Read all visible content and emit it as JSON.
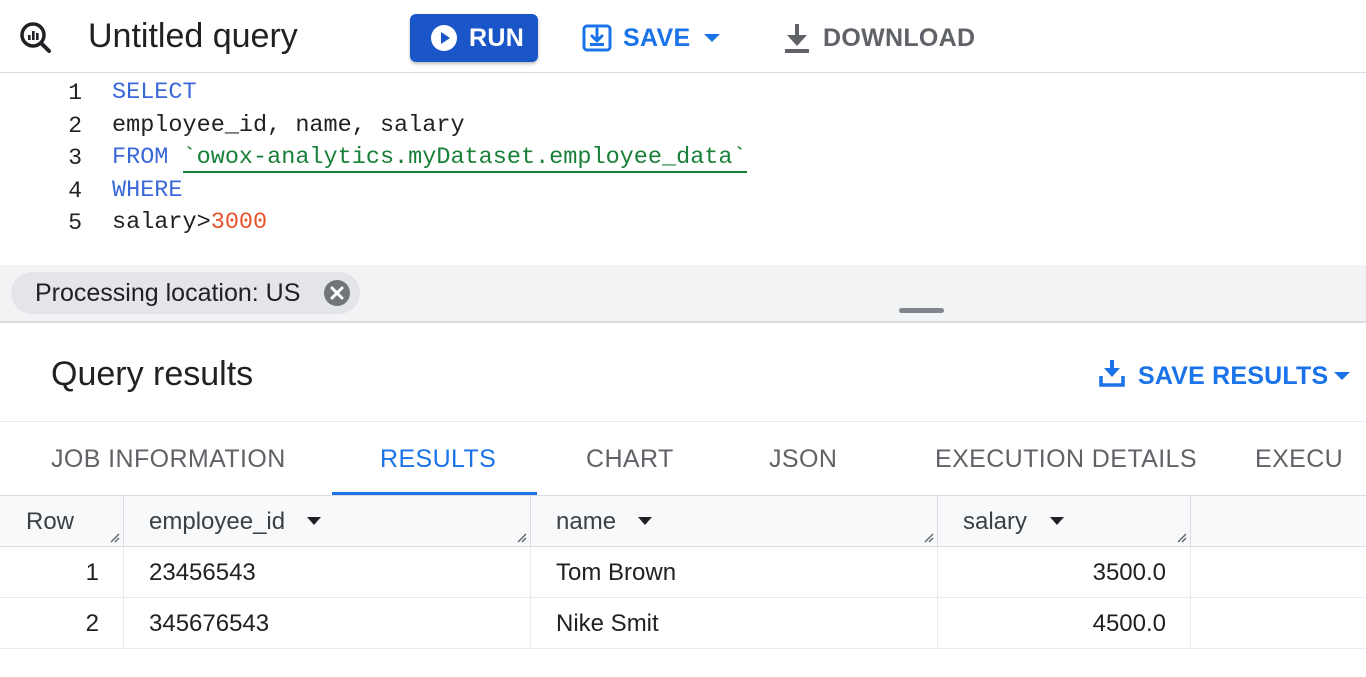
{
  "toolbar": {
    "title": "Untitled query",
    "run_label": "RUN",
    "save_label": "SAVE",
    "download_label": "DOWNLOAD"
  },
  "editor": {
    "line_numbers": [
      "1",
      "2",
      "3",
      "4",
      "5"
    ],
    "lines": [
      [
        {
          "text": "SELECT",
          "type": "kw"
        }
      ],
      [
        {
          "text": "employee_id, name, salary",
          "type": "plain"
        }
      ],
      [
        {
          "text": "FROM ",
          "type": "kw"
        },
        {
          "text": "`owox-analytics.myDataset.employee_data`",
          "type": "str"
        }
      ],
      [
        {
          "text": "WHERE",
          "type": "kw"
        }
      ],
      [
        {
          "text": "salary>",
          "type": "plain"
        },
        {
          "text": "3000",
          "type": "num"
        }
      ]
    ]
  },
  "processing_chip": {
    "label": "Processing location: US"
  },
  "results": {
    "title": "Query results",
    "save_results_label": "SAVE RESULTS",
    "tabs": [
      {
        "label": "JOB INFORMATION",
        "active": false
      },
      {
        "label": "RESULTS",
        "active": true
      },
      {
        "label": "CHART",
        "active": false
      },
      {
        "label": "JSON",
        "active": false
      },
      {
        "label": "EXECUTION DETAILS",
        "active": false
      },
      {
        "label": "EXECU",
        "active": false
      }
    ],
    "table": {
      "columns": [
        "Row",
        "employee_id",
        "name",
        "salary"
      ],
      "rows": [
        [
          "1",
          "23456543",
          "Tom Brown",
          "3500.0"
        ],
        [
          "2",
          "345676543",
          "Nike Smit",
          "4500.0"
        ]
      ]
    }
  },
  "colors": {
    "accent_blue": "#1a73e8",
    "run_button_blue": "#1a56c8",
    "keyword_blue": "#3b68d8",
    "string_green": "#188038",
    "number_orange": "#e8522c"
  },
  "icons": {
    "query": "query-magnifier-icon",
    "run": "play-icon",
    "save": "save-icon",
    "download": "download-icon",
    "chip_close": "close-circle-icon",
    "save_results": "download-icon",
    "dropdown": "caret-down-icon",
    "sort": "sort-caret-icon",
    "resize": "column-resize-icon"
  }
}
